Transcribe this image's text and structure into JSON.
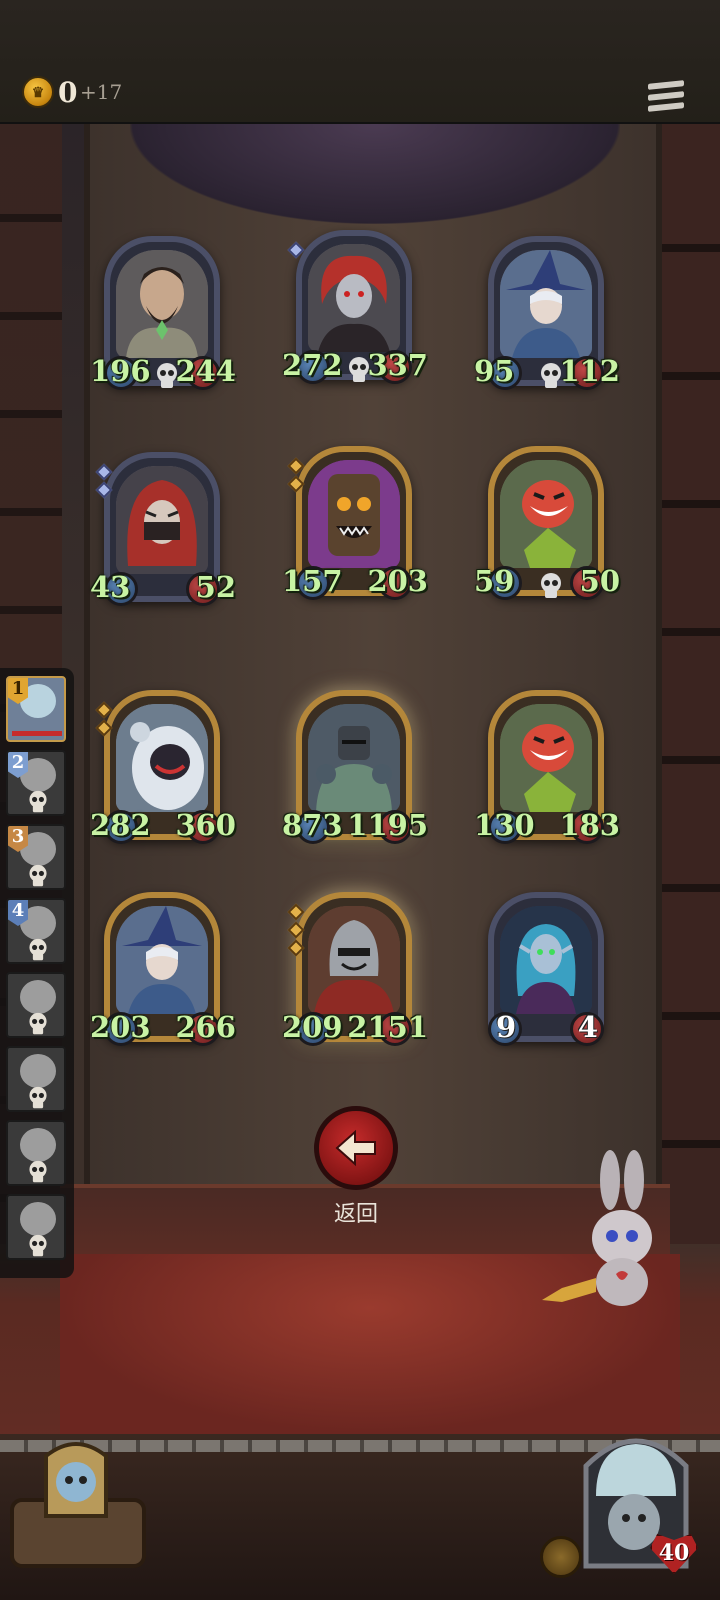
{
  "header": {
    "gold": "0",
    "gold_income": "+17"
  },
  "board": {
    "rows": [
      [
        {
          "attack": "196",
          "health": "244",
          "frame": "silver",
          "skull": true
        },
        {
          "attack": "272",
          "health": "337",
          "frame": "silver",
          "skull": true
        },
        {
          "attack": "95",
          "health": "112",
          "frame": "silver",
          "skull": true
        }
      ],
      [
        {
          "attack": "43",
          "health": "52",
          "frame": "silver",
          "skull": false
        },
        {
          "attack": "157",
          "health": "203",
          "frame": "gold",
          "skull": false
        },
        {
          "attack": "59",
          "health": "50",
          "frame": "gold",
          "skull": true
        }
      ],
      [
        {
          "attack": "282",
          "health": "360",
          "frame": "gold",
          "skull": false
        },
        {
          "attack": "873",
          "health": "1195",
          "frame": "gold",
          "skull": false
        },
        {
          "attack": "130",
          "health": "183",
          "frame": "gold",
          "skull": false
        }
      ],
      [
        {
          "attack": "203",
          "health": "266",
          "frame": "gold",
          "skull": false
        },
        {
          "attack": "209",
          "health": "2151",
          "frame": "gold",
          "skull": false
        },
        {
          "attack": "9",
          "health": "4",
          "frame": "silver",
          "skull": false
        }
      ]
    ]
  },
  "sidebar": {
    "placements": [
      "1",
      "2",
      "3",
      "4"
    ]
  },
  "back_button": {
    "label": "返回"
  },
  "player": {
    "health": "40"
  },
  "colors": {
    "stat_text": "#c8f3a4",
    "attack_orb": "#3a5a88",
    "health_orb": "#9a2d2d",
    "gold_frame": "#b4873a",
    "silver_frame": "#4b4f67"
  }
}
